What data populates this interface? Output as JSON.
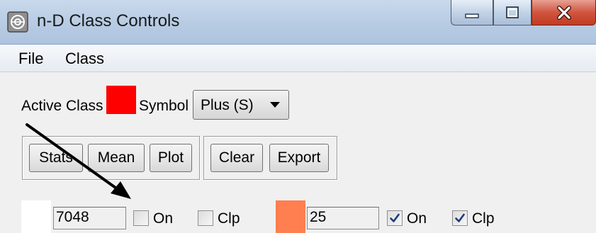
{
  "window": {
    "title": "n-D Class Controls",
    "icon": "app-icon"
  },
  "title_controls": {
    "minimize_icon": "minimize-icon",
    "maximize_icon": "maximize-icon",
    "close_icon": "close-icon"
  },
  "menu": {
    "items": [
      {
        "label": "File"
      },
      {
        "label": "Class"
      }
    ]
  },
  "active_class": {
    "label": "Active Class",
    "color": "#ff0000",
    "symbol_label": "Symbol",
    "symbol_value": "Plus (S)"
  },
  "buttons": {
    "stats": "Stats",
    "mean": "Mean",
    "plot": "Plot",
    "clear": "Clear",
    "export": "Export"
  },
  "class_rows": [
    {
      "color": "#ffffff",
      "count": "7048",
      "on_label": "On",
      "on_checked": false,
      "clp_label": "Clp",
      "clp_checked": false
    },
    {
      "color": "#ff7f50",
      "count": "25",
      "on_label": "On",
      "on_checked": true,
      "clp_label": "Clp",
      "clp_checked": true
    }
  ],
  "annotation": {
    "arrow_color": "#000000"
  }
}
